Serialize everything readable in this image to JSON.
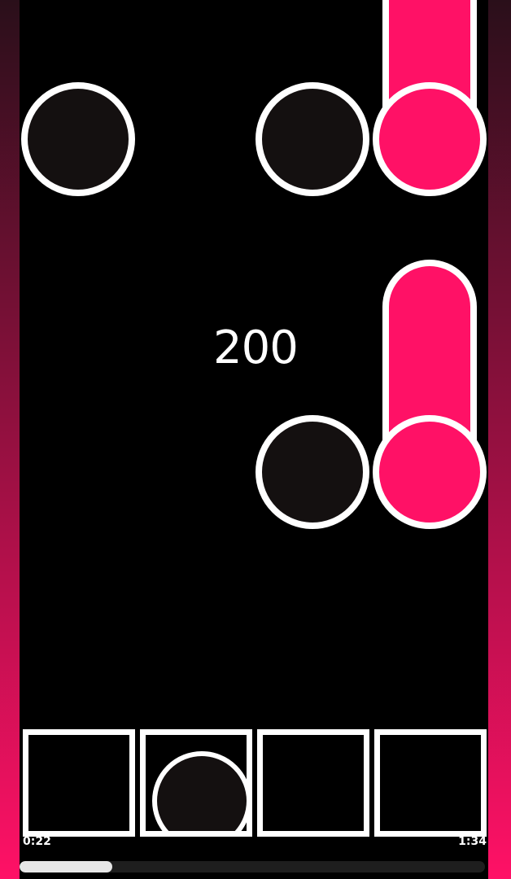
{
  "colors": {
    "background": "#000000",
    "note_pink": "#ff1166",
    "note_dark": "#141010",
    "outline": "#ffffff",
    "border_gradient_top": "#2a0f1a",
    "border_gradient_bottom": "#ff1166"
  },
  "score": "200",
  "timer": {
    "elapsed": "0:22",
    "total": "1:34"
  },
  "progress": 0.2,
  "notes": [
    {
      "lane": 1,
      "type": "tap",
      "color": "dark"
    },
    {
      "lane": 3,
      "type": "tap",
      "color": "dark"
    },
    {
      "lane": 4,
      "type": "hold",
      "color": "pink"
    },
    {
      "lane": 3,
      "type": "tap",
      "color": "dark"
    },
    {
      "lane": 4,
      "type": "hold",
      "color": "pink"
    }
  ],
  "hit_lanes": [
    {
      "lane": 1,
      "occupied": false
    },
    {
      "lane": 2,
      "occupied": true
    },
    {
      "lane": 3,
      "occupied": false
    },
    {
      "lane": 4,
      "occupied": false
    }
  ]
}
